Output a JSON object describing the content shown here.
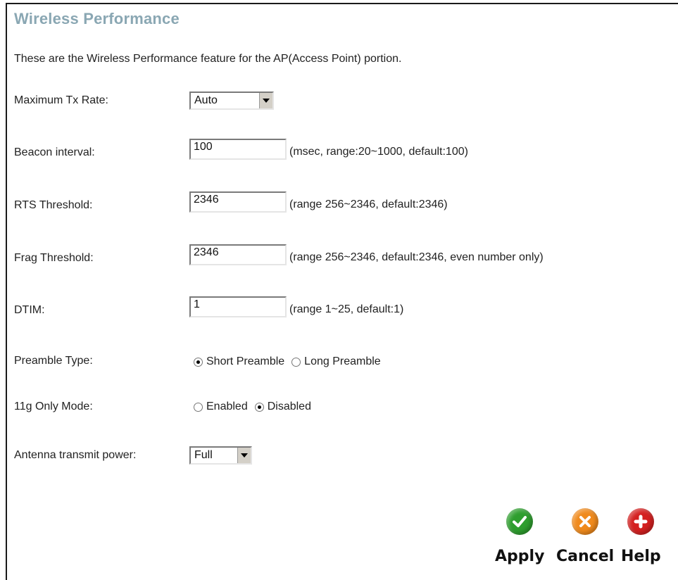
{
  "page": {
    "title": "Wireless Performance",
    "intro": "These are the Wireless Performance feature for the AP(Access Point) portion."
  },
  "fields": {
    "max_tx_rate": {
      "label": "Maximum Tx Rate:",
      "value": "Auto"
    },
    "beacon_interval": {
      "label": "Beacon interval:",
      "value": "100",
      "hint": "(msec, range:20~1000, default:100)"
    },
    "rts_threshold": {
      "label": "RTS Threshold:",
      "value": "2346",
      "hint": "(range 256~2346, default:2346)"
    },
    "frag_threshold": {
      "label": "Frag Threshold:",
      "value": "2346",
      "hint": "(range 256~2346, default:2346, even number only)"
    },
    "dtim": {
      "label": "DTIM:",
      "value": "1",
      "hint": "(range 1~25, default:1)"
    },
    "preamble_type": {
      "label": "Preamble Type:",
      "options": [
        "Short Preamble",
        "Long Preamble"
      ],
      "selected": "Short Preamble"
    },
    "g_only_mode": {
      "label": "11g Only Mode:",
      "options": [
        "Enabled",
        "Disabled"
      ],
      "selected": "Disabled"
    },
    "antenna_power": {
      "label": "Antenna transmit power:",
      "value": "Full"
    }
  },
  "actions": {
    "apply": {
      "label": "Apply",
      "color": "#2e9e2e"
    },
    "cancel": {
      "label": "Cancel",
      "color": "#f08a1c"
    },
    "help": {
      "label": "Help",
      "color": "#d42020"
    }
  },
  "colors": {
    "title": "#8aa7b3"
  }
}
